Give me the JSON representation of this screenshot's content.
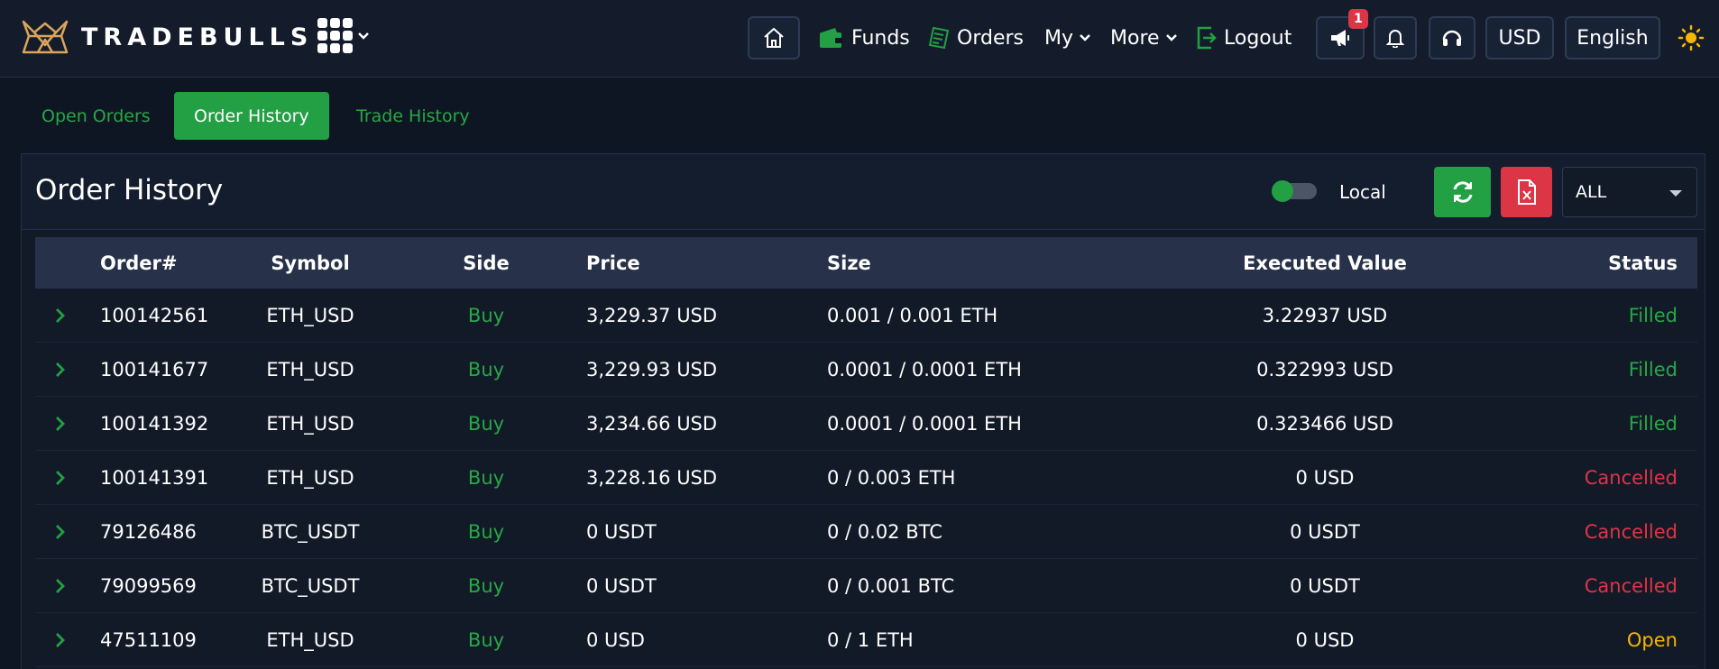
{
  "brand": {
    "name": "TRADEBULLS"
  },
  "nav": {
    "funds": "Funds",
    "orders": "Orders",
    "my": "My",
    "more": "More",
    "logout": "Logout",
    "announcements_count": "1",
    "currency": "USD",
    "language": "English",
    "icons": [
      "home-icon",
      "wallet-icon",
      "orders-icon",
      "logout-icon",
      "megaphone-icon",
      "bell-icon",
      "headset-icon",
      "sun-icon",
      "apps-grid-icon"
    ]
  },
  "tabs": [
    {
      "label": "Open Orders",
      "active": false
    },
    {
      "label": "Order History",
      "active": true
    },
    {
      "label": "Trade History",
      "active": false
    }
  ],
  "panel": {
    "title": "Order History",
    "toggle_label": "Local",
    "filter_value": "ALL"
  },
  "table": {
    "headers": {
      "order": "Order#",
      "symbol": "Symbol",
      "side": "Side",
      "price": "Price",
      "size": "Size",
      "executed_value": "Executed Value",
      "status": "Status"
    },
    "rows": [
      {
        "order": "100142561",
        "symbol": "ETH_USD",
        "side": "Buy",
        "price": "3,229.37 USD",
        "size": "0.001 / 0.001 ETH",
        "executed_value": "3.22937 USD",
        "status": "Filled"
      },
      {
        "order": "100141677",
        "symbol": "ETH_USD",
        "side": "Buy",
        "price": "3,229.93 USD",
        "size": "0.0001 / 0.0001 ETH",
        "executed_value": "0.322993 USD",
        "status": "Filled"
      },
      {
        "order": "100141392",
        "symbol": "ETH_USD",
        "side": "Buy",
        "price": "3,234.66 USD",
        "size": "0.0001 / 0.0001 ETH",
        "executed_value": "0.323466 USD",
        "status": "Filled"
      },
      {
        "order": "100141391",
        "symbol": "ETH_USD",
        "side": "Buy",
        "price": "3,228.16 USD",
        "size": "0 / 0.003 ETH",
        "executed_value": "0 USD",
        "status": "Cancelled"
      },
      {
        "order": "79126486",
        "symbol": "BTC_USDT",
        "side": "Buy",
        "price": "0 USDT",
        "size": "0 / 0.02 BTC",
        "executed_value": "0 USDT",
        "status": "Cancelled"
      },
      {
        "order": "79099569",
        "symbol": "BTC_USDT",
        "side": "Buy",
        "price": "0 USDT",
        "size": "0 / 0.001 BTC",
        "executed_value": "0 USDT",
        "status": "Cancelled"
      },
      {
        "order": "47511109",
        "symbol": "ETH_USD",
        "side": "Buy",
        "price": "0 USD",
        "size": "0 / 1 ETH",
        "executed_value": "0 USD",
        "status": "Open"
      }
    ]
  },
  "colors": {
    "accent_green": "#22a043",
    "danger_red": "#dc3545",
    "open_amber": "#f5b700",
    "background": "#0f1623"
  }
}
